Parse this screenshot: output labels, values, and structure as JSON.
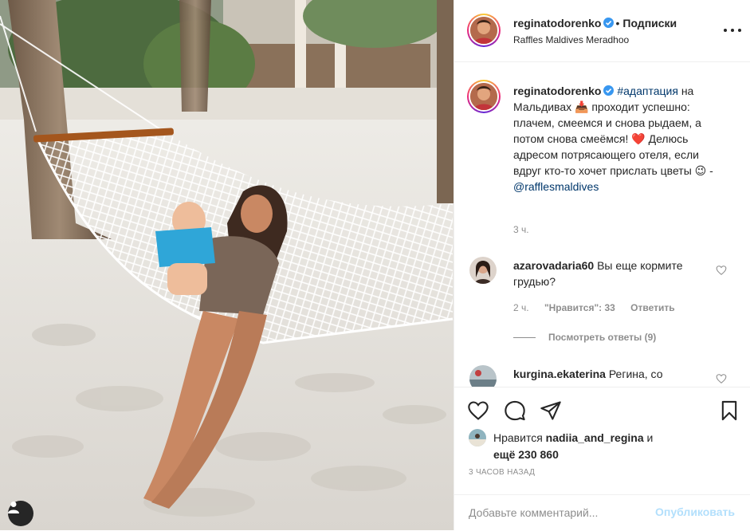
{
  "post": {
    "author": "reginatodorenko",
    "verified": true,
    "follow_separator": "•",
    "follow_label": "Подписки",
    "location": "Raffles Maldives Meradhoo",
    "more_icon": "ellipsis-icon",
    "photo_user_icon": "user-tag-icon"
  },
  "caption": {
    "username": "reginatodorenko",
    "hashtag": "#адаптация",
    "text_1": " на Мальдивах",
    "emoji_1": "📥",
    "text_2": " проходит успешно: плачем, смеемся и снова рыдаем, а потом снова смеёмся!",
    "emoji_2": "❤️",
    "text_3": " Делюсь адресом потрясающего отеля, если вдруг кто-то хочет прислать цветы",
    "emoji_3": "😉",
    "text_4": " -",
    "mention": "@rafflesmaldives",
    "time": "3 ч."
  },
  "comments": [
    {
      "username": "azarovadaria60",
      "text": "Вы еще кормите грудью?",
      "time": "2 ч.",
      "likes": "\"Нравится\": 33",
      "reply_label": "Ответить",
      "view_replies": "Посмотреть ответы (9)"
    },
    {
      "username": "kurgina.ekaterina",
      "text": "Регина, со"
    }
  ],
  "likes": {
    "prefix": "Нравится",
    "user": "nadiia_and_regina",
    "conj": " и",
    "more": "ещё 230 860"
  },
  "time_ago": "3 ЧАСОВ НАЗАД",
  "comment_input": {
    "placeholder": "Добавьте комментарий..."
  },
  "publish_label": "Опубликовать",
  "colors": {
    "link": "#00376b",
    "muted": "#8e8e8e",
    "publish_disabled": "#b2dffc",
    "verified": "#3897f0",
    "heart": "#ed4956"
  }
}
